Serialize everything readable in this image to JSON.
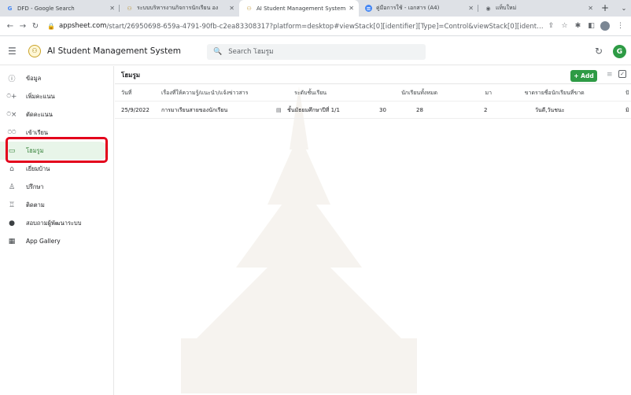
{
  "browser": {
    "tabs": [
      {
        "icon": "google-icon",
        "title": "DFD - Google Search",
        "active": false
      },
      {
        "icon": "appsheet-icon",
        "title": "ระบบบริหารงานกิจการนักเรียน อง",
        "active": false
      },
      {
        "icon": "appsheet-icon",
        "title": "AI Student Management System",
        "active": true
      },
      {
        "icon": "docs-icon",
        "title": "คู่มือการใช้ - เอกสาร (A4)",
        "active": false
      },
      {
        "icon": "chrome-icon",
        "title": "แท็บใหม่",
        "active": false
      }
    ],
    "url_host": "appsheet.com",
    "url_path": "/start/26950698-659a-4791-90fb-c2ea83308317?platform=desktop#viewStack[0][identifier][Type]=Control&viewStack[0][identifier][Name]=โฮมรู..."
  },
  "app": {
    "title": "AI Student Management System",
    "search_placeholder": "Search โฮมรูม",
    "avatar_letter": "G"
  },
  "sidebar": {
    "items": [
      {
        "icon": "info-icon",
        "label": "ข้อมูล"
      },
      {
        "icon": "person-add-icon",
        "label": "เพิ่มคะแนน"
      },
      {
        "icon": "person-remove-icon",
        "label": "ตัดคะแนน"
      },
      {
        "icon": "people-icon",
        "label": "เข้าเรียน"
      },
      {
        "icon": "classroom-icon",
        "label": "โฮมรูม",
        "active": true
      },
      {
        "icon": "home-visit-icon",
        "label": "เยี่ยมบ้าน"
      },
      {
        "icon": "consult-icon",
        "label": "ปรึกษา"
      },
      {
        "icon": "followup-icon",
        "label": "ติดตาม"
      },
      {
        "icon": "info-filled-icon",
        "label": "สอบถามผู้พัฒนาระบบ"
      },
      {
        "icon": "grid-icon",
        "label": "App Gallery"
      }
    ]
  },
  "view": {
    "title": "โฮมรูม",
    "add_label": "+ Add",
    "columns": [
      "วันที่",
      "เรื่องที่ให้ความรู้/แนะนำ/แจ้งข่าวสาร",
      "ระดับชั้นเรียน",
      "นักเรียนทั้งหมด",
      "มา",
      "ขาด",
      "รายชื่อนักเรียนที่ขาด",
      "ปั"
    ],
    "rows": [
      [
        "25/9/2022",
        "การมาเรียนสายของนักเรียน",
        "ชั้นมัธยมศึกษาปีที่ 1/1",
        "30",
        "28",
        "2",
        "วันดี,วันชนะ",
        "มิ"
      ]
    ]
  },
  "colors": {
    "accent_green": "#2e9b45",
    "highlight_red": "#e3001b"
  }
}
